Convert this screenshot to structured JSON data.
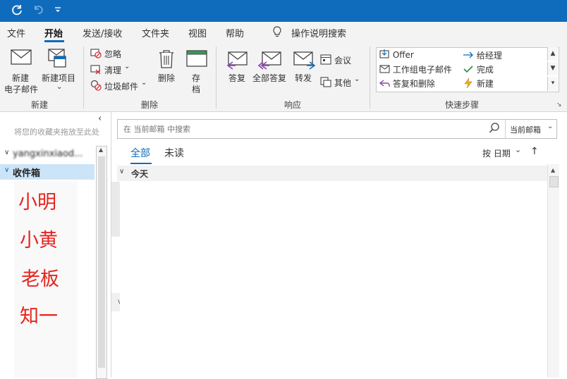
{
  "quick_access": {
    "sync_icon": "sync-icon",
    "undo_icon": "undo-icon",
    "customize_icon": "customize-icon"
  },
  "menu": {
    "tabs": [
      {
        "label": "文件"
      },
      {
        "label": "开始"
      },
      {
        "label": "发送/接收"
      },
      {
        "label": "文件夹"
      },
      {
        "label": "视图"
      },
      {
        "label": "帮助"
      }
    ],
    "active_index": 1,
    "tell_me": "操作说明搜索"
  },
  "ribbon": {
    "new_group": {
      "new_email_line1": "新建",
      "new_email_line2": "电子邮件",
      "new_items": "新建项目",
      "label": "新建"
    },
    "delete_group": {
      "ignore": "忽略",
      "cleanup": "清理",
      "junk": "垃圾邮件",
      "delete": "删除",
      "archive_line1": "存",
      "archive_line2": "档",
      "label": "删除"
    },
    "respond_group": {
      "reply": "答复",
      "reply_all": "全部答复",
      "forward": "转发",
      "meeting": "会议",
      "more": "其他",
      "label": "响应"
    },
    "quick_steps": {
      "items": [
        {
          "label": "Offer"
        },
        {
          "label": "给经理"
        },
        {
          "label": "工作组电子邮件"
        },
        {
          "label": "完成"
        },
        {
          "label": "答复和删除"
        },
        {
          "label": "新建"
        }
      ],
      "label": "快速步骤"
    }
  },
  "folder_pane": {
    "favorites_hint": "将您的收藏夹拖放至此处",
    "account": "yangxinxiaod...",
    "inbox": "收件箱",
    "names": [
      "小明",
      "小黄",
      "老板",
      "知一"
    ]
  },
  "search": {
    "placeholder": "在 当前邮箱 中搜索",
    "scope": "当前邮箱"
  },
  "message_list": {
    "filter_all": "全部",
    "filter_unread": "未读",
    "sort": "按 日期",
    "group_today": "今天"
  },
  "colors": {
    "accent": "#0f6cbd",
    "names_red": "#e8241f",
    "inbox_selected": "#cce4f7"
  }
}
